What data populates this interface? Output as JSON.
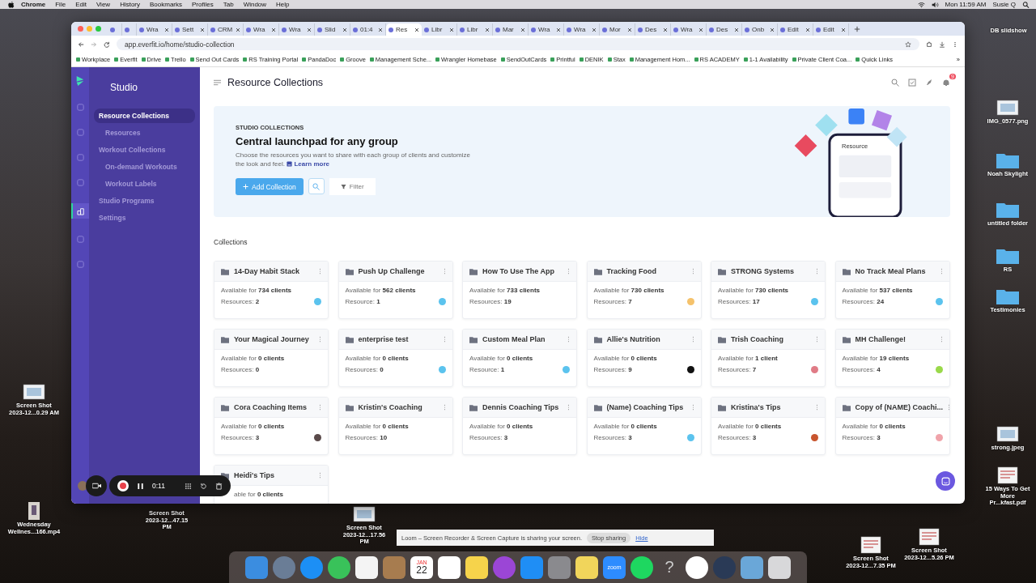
{
  "menu_bar": {
    "app": "Chrome",
    "items": [
      "File",
      "Edit",
      "View",
      "History",
      "Bookmarks",
      "Profiles",
      "Tab",
      "Window",
      "Help"
    ],
    "clock": "Mon 11:59 AM",
    "user": "Susie Q"
  },
  "browser": {
    "tabs": [
      {
        "kind": "icon",
        "selected": false
      },
      {
        "kind": "icon",
        "selected": false
      },
      {
        "kind": "text",
        "label": "Wra",
        "selected": false
      },
      {
        "kind": "text",
        "label": "Sett",
        "selected": false
      },
      {
        "kind": "text",
        "label": "CRM",
        "selected": false
      },
      {
        "kind": "text",
        "label": "Wra",
        "selected": false
      },
      {
        "kind": "text",
        "label": "Wra",
        "selected": false
      },
      {
        "kind": "text",
        "label": "Slid",
        "selected": false
      },
      {
        "kind": "text",
        "label": "01:4",
        "selected": false
      },
      {
        "kind": "text",
        "label": "Res",
        "selected": true
      },
      {
        "kind": "text",
        "label": "Libr",
        "selected": false
      },
      {
        "kind": "text",
        "label": "Libr",
        "selected": false
      },
      {
        "kind": "text",
        "label": "Mar",
        "selected": false
      },
      {
        "kind": "text",
        "label": "Wra",
        "selected": false
      },
      {
        "kind": "text",
        "label": "Wra",
        "selected": false
      },
      {
        "kind": "text",
        "label": "Mor",
        "selected": false
      },
      {
        "kind": "text",
        "label": "Des",
        "selected": false
      },
      {
        "kind": "text",
        "label": "Wra",
        "selected": false
      },
      {
        "kind": "text",
        "label": "Des",
        "selected": false
      },
      {
        "kind": "text",
        "label": "Onb",
        "selected": false
      },
      {
        "kind": "text",
        "label": "Edit",
        "selected": false
      },
      {
        "kind": "text",
        "label": "Edit",
        "selected": false
      }
    ],
    "url": "app.everfit.io/home/studio-collection",
    "bookmarks": [
      "Workplace",
      "Everfit",
      "Drive",
      "Trello",
      "Send Out Cards",
      "RS Training Portal",
      "PandaDoc",
      "Groove",
      "Management Sche...",
      "Wrangler Homebase",
      "SendOutCards",
      "Printful",
      "DENIK",
      "Stax",
      "Management Hom...",
      "RS ACADEMY",
      "1-1 Availability",
      "Private Client Coa...",
      "Quick Links"
    ],
    "bookmarks_more": "»"
  },
  "app": {
    "brand": "Studio",
    "nav": [
      {
        "label": "Resource Collections",
        "selected": true,
        "children": [
          {
            "label": "Resources",
            "selected": false
          }
        ]
      },
      {
        "label": "Workout Collections",
        "selected": false,
        "children": [
          {
            "label": "On-demand Workouts",
            "selected": false
          },
          {
            "label": "Workout Labels",
            "selected": false
          }
        ]
      },
      {
        "label": "Studio Programs",
        "selected": false
      },
      {
        "label": "Settings",
        "selected": false
      }
    ],
    "page_title": "Resource Collections",
    "notification_badge": "9",
    "banner": {
      "eyebrow": "STUDIO COLLECTIONS",
      "heading": "Central launchpad for any group",
      "description": "Choose the resources you want to share with each group of clients and customize the look and feel.",
      "link": "Learn more",
      "add_button": "Add Collection",
      "filter_button": "Filter",
      "illustration_label": "Resource"
    },
    "section_title": "Collections",
    "collections": [
      {
        "title": "14-Day Habit Stack",
        "availability": "Available for **734 clients**",
        "resources": "Resources: **2**",
        "color": "#5bc3ee"
      },
      {
        "title": "Push Up Challenge",
        "availability": "Available for **562 clients**",
        "resources": "Resource: **1**",
        "color": "#5bc3ee"
      },
      {
        "title": "How To Use The App",
        "availability": "Available for **733 clients**",
        "resources": "Resources: **19**"
      },
      {
        "title": "Tracking Food",
        "availability": "Available for **730 clients**",
        "resources": "Resources: **7**",
        "color": "#f5c26b"
      },
      {
        "title": "STRONG Systems",
        "availability": "Available for **730 clients**",
        "resources": "Resources: **17**",
        "color": "#5bc3ee"
      },
      {
        "title": "No Track Meal Plans",
        "availability": "Available for **537 clients**",
        "resources": "Resources: **24**",
        "color": "#5bc3ee"
      },
      {
        "title": "Your Magical Journey",
        "availability": "Available for **0 clients**",
        "resources": "Resources: **0**"
      },
      {
        "title": "enterprise test",
        "availability": "Available for **0 clients**",
        "resources": "Resources: **0**",
        "color": "#5bc3ee"
      },
      {
        "title": "Custom Meal Plan",
        "availability": "Available for **0 clients**",
        "resources": "Resource: **1**",
        "color": "#5bc3ee"
      },
      {
        "title": "Allie's Nutrition",
        "availability": "Available for **0 clients**",
        "resources": "Resources: **9**",
        "color": "#111111"
      },
      {
        "title": "Trish Coaching",
        "availability": "Available for **1 client**",
        "resources": "Resources: **7**",
        "color": "#e07b86"
      },
      {
        "title": "MH Challenge!",
        "availability": "Available for **19 clients**",
        "resources": "Resources: **4**",
        "color": "#9ad94a"
      },
      {
        "title": "Cora Coaching Items",
        "availability": "Available for **0 clients**",
        "resources": "Resources: **3**",
        "color": "#5a4a4a"
      },
      {
        "title": "Kristin's Coaching",
        "availability": "Available for **0 clients**",
        "resources": "Resources: **10**"
      },
      {
        "title": "Dennis Coaching Tips",
        "availability": "Available for **0 clients**",
        "resources": "Resources: **3**"
      },
      {
        "title": "(Name) Coaching Tips",
        "availability": "Available for **0 clients**",
        "resources": "Resources: **3**",
        "color": "#5bc3ee"
      },
      {
        "title": "Kristina's Tips",
        "availability": "Available for **0 clients**",
        "resources": "Resources: **3**",
        "color": "#c8552e"
      },
      {
        "title": "Copy of (NAME) Coachi...",
        "availability": "Available for **0 clients**",
        "resources": "Resources: **3**",
        "color": "#f0a3aa"
      },
      {
        "title": "Heidi's Tips",
        "availability": "able for **0 clients**",
        "clipped_left": true
      }
    ]
  },
  "recorder": {
    "time": "0:11"
  },
  "loom_banner": {
    "message": "Loom – Screen Recorder & Screen Capture is sharing your screen.",
    "stop": "Stop sharing",
    "hide": "Hide"
  },
  "desktop_icons": [
    {
      "label": "DB slidshow"
    },
    {
      "label": "IMG_0577.png",
      "kind": "image"
    },
    {
      "label": "Noah Skylight",
      "kind": "folder"
    },
    {
      "label": "untitled folder",
      "kind": "folder"
    },
    {
      "label": "RS",
      "kind": "folder"
    },
    {
      "label": "Testimonies",
      "kind": "folder"
    },
    {
      "label": "strong.jpeg",
      "kind": "image"
    },
    {
      "label": "15 Ways To Get More Pr...kfast.pdf",
      "kind": "doc"
    },
    {
      "label": "Screen Shot 2023-12...7.35 PM",
      "kind": "doc"
    },
    {
      "label": "Screen Shot 2023-12...5.26 PM",
      "kind": "doc"
    },
    {
      "label": "Screen Shot 2023-12...0.29 AM",
      "kind": "image"
    },
    {
      "label": "Wednesday Wellnes...166.mp4",
      "kind": "video"
    },
    {
      "label": "Screen Shot 2023-12...47.15 PM"
    },
    {
      "label": "Screen Shot 2023-12...17.56 PM",
      "kind": "image"
    }
  ],
  "dock": [
    {
      "kind": "finder"
    },
    {
      "kind": "launchpad"
    },
    {
      "kind": "safari"
    },
    {
      "kind": "messages"
    },
    {
      "kind": "photos"
    },
    {
      "kind": "contacts"
    },
    {
      "kind": "calendar",
      "month": "JAN",
      "day": "22"
    },
    {
      "kind": "reminders"
    },
    {
      "kind": "notes"
    },
    {
      "kind": "podcasts"
    },
    {
      "kind": "appstore"
    },
    {
      "kind": "settings"
    },
    {
      "kind": "stickies"
    },
    {
      "kind": "zoom",
      "text": "zoom"
    },
    {
      "kind": "spotify"
    },
    {
      "kind": "help",
      "text": "?"
    },
    {
      "kind": "chrome"
    },
    {
      "kind": "quicktime"
    },
    {
      "kind": "preview"
    },
    {
      "kind": "trash"
    }
  ]
}
